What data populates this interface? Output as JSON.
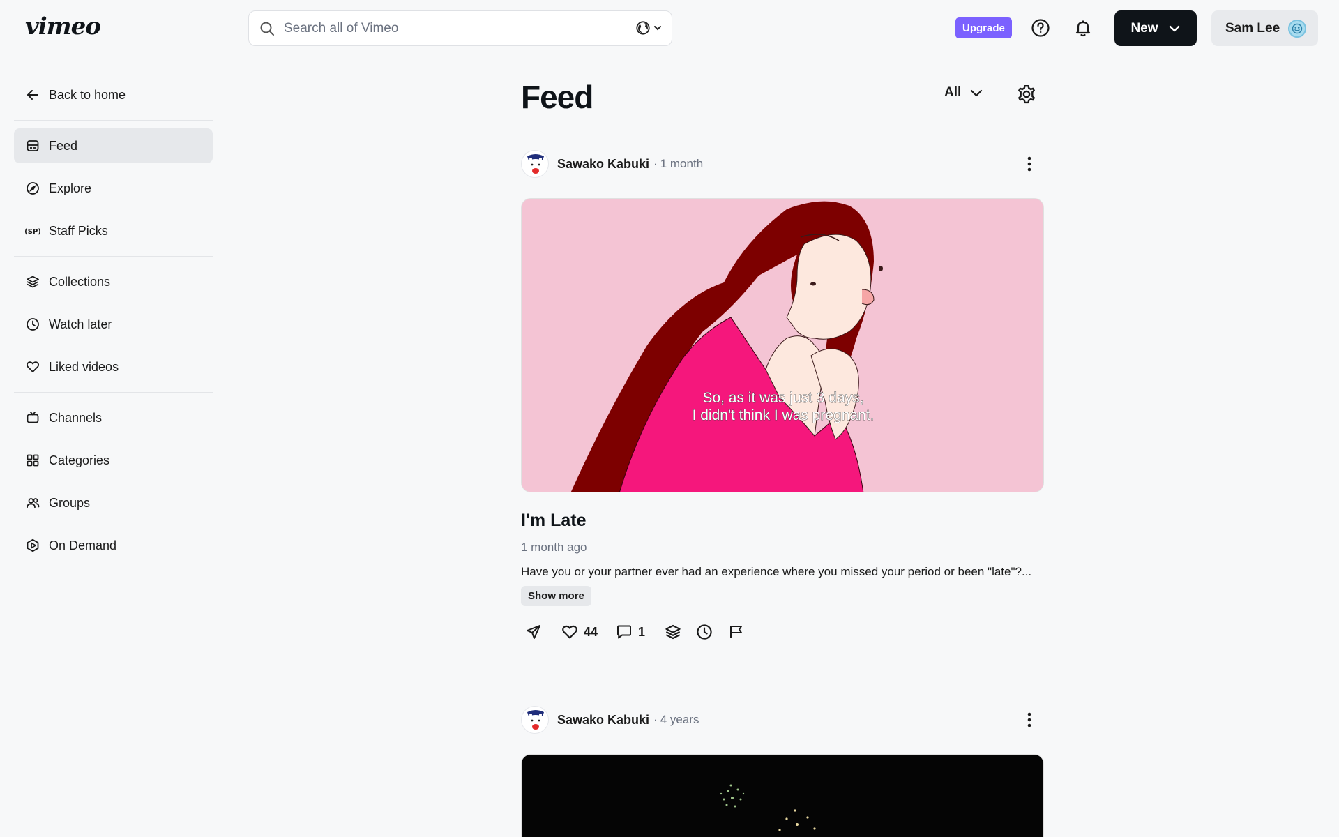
{
  "header": {
    "logo_text": "vimeo",
    "search_placeholder": "Search all of Vimeo",
    "upgrade_label": "Upgrade",
    "new_label": "New",
    "user_name": "Sam Lee"
  },
  "sidebar": {
    "back_label": "Back to home",
    "groups": [
      [
        {
          "label": "Feed",
          "icon": "feed-icon",
          "active": true
        },
        {
          "label": "Explore",
          "icon": "compass-icon"
        },
        {
          "label": "Staff Picks",
          "icon": "staff-picks-icon"
        }
      ],
      [
        {
          "label": "Collections",
          "icon": "layers-icon"
        },
        {
          "label": "Watch later",
          "icon": "clock-icon"
        },
        {
          "label": "Liked videos",
          "icon": "heart-icon"
        }
      ],
      [
        {
          "label": "Channels",
          "icon": "tv-icon"
        },
        {
          "label": "Categories",
          "icon": "grid-icon"
        },
        {
          "label": "Groups",
          "icon": "users-icon"
        },
        {
          "label": "On Demand",
          "icon": "play-hex-icon"
        }
      ]
    ]
  },
  "feed": {
    "title": "Feed",
    "filter_label": "All",
    "posts": [
      {
        "author": "Sawako Kabuki",
        "age": "1 month",
        "subtitle_line1": "So, as it was just 3 days,",
        "subtitle_line2": "I didn't think I was pregnant.",
        "title": "I'm Late",
        "date": "1 month ago",
        "description": "Have you or your partner ever had an experience where you missed your period or been \"late\"?...",
        "show_more_label": "Show more",
        "likes": "44",
        "comments": "1"
      },
      {
        "author": "Sawako Kabuki",
        "age": "4 years"
      }
    ]
  },
  "colors": {
    "accent_purple": "#7b61ff",
    "dark": "#0f1419",
    "thumbnail_pink": "#f4c4d4",
    "shirt_pink": "#f5177c",
    "hair_red": "#7d0000"
  }
}
